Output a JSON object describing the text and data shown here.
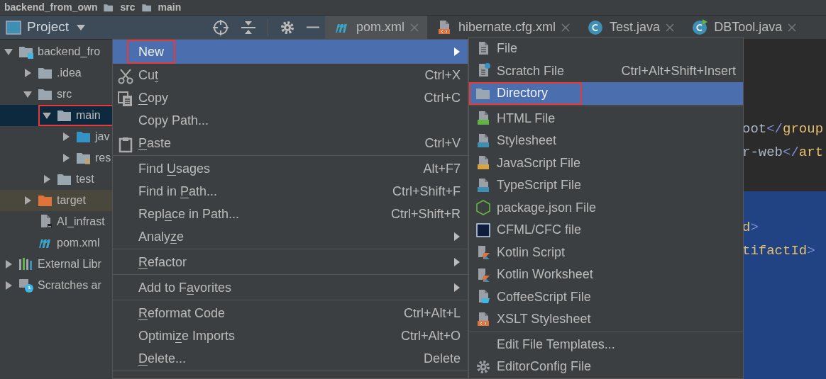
{
  "breadcrumb": [
    {
      "label": "backend_from_own",
      "kind": "project"
    },
    {
      "label": "src",
      "kind": "folder"
    },
    {
      "label": "main",
      "kind": "folder"
    }
  ],
  "project_panel": {
    "title": "Project"
  },
  "tabs": [
    {
      "label": "pom.xml",
      "kind": "maven",
      "selected": true
    },
    {
      "label": "hibernate.cfg.xml",
      "kind": "xml",
      "selected": false
    },
    {
      "label": "Test.java",
      "kind": "class",
      "selected": false
    },
    {
      "label": "DBTool.java",
      "kind": "runclass",
      "selected": false
    }
  ],
  "tree": [
    {
      "label": "backend_fro",
      "kind": "module",
      "expanded": true,
      "selected": false,
      "highlighted": false,
      "boxed": false,
      "children": [
        {
          "label": ".idea",
          "kind": "folder",
          "expanded": false,
          "selected": false,
          "highlighted": false,
          "boxed": false
        },
        {
          "label": "src",
          "kind": "folder",
          "expanded": true,
          "selected": false,
          "highlighted": false,
          "boxed": false,
          "children": [
            {
              "label": "main",
              "kind": "folder",
              "expanded": true,
              "selected": true,
              "highlighted": false,
              "boxed": true,
              "children": [
                {
                  "label": "jav",
                  "kind": "source",
                  "expanded": false,
                  "selected": false,
                  "highlighted": false,
                  "boxed": false
                },
                {
                  "label": "res",
                  "kind": "resources",
                  "expanded": false,
                  "selected": false,
                  "highlighted": false,
                  "boxed": false
                }
              ]
            },
            {
              "label": "test",
              "kind": "folder",
              "expanded": false,
              "selected": false,
              "highlighted": false,
              "boxed": false
            }
          ]
        },
        {
          "label": "target",
          "kind": "excluded",
          "expanded": false,
          "selected": false,
          "highlighted": true,
          "boxed": false
        },
        {
          "label": "AI_infrast",
          "kind": "iml",
          "selected": false,
          "highlighted": false,
          "boxed": false
        },
        {
          "label": "pom.xml",
          "kind": "maven",
          "selected": false,
          "highlighted": false,
          "boxed": false
        }
      ]
    },
    {
      "label": "External Libr",
      "kind": "library",
      "expanded": false,
      "selected": false,
      "highlighted": false,
      "boxed": false
    },
    {
      "label": "Scratches ar",
      "kind": "scratches",
      "expanded": false,
      "selected": false,
      "highlighted": false,
      "boxed": false
    }
  ],
  "editor": {
    "lines": [
      {
        "selected": false,
        "tokens": [
          {
            "text": "oot",
            "kind": "text"
          },
          {
            "text": "</",
            "kind": "bracket"
          },
          {
            "text": "group",
            "kind": "tag"
          }
        ]
      },
      {
        "selected": false,
        "tokens": [
          {
            "text": "r-web",
            "kind": "text"
          },
          {
            "text": "</",
            "kind": "bracket"
          },
          {
            "text": "art",
            "kind": "tag"
          }
        ]
      },
      {
        "selected": true,
        "tokens": [
          {
            "text": "d",
            "kind": "tag"
          },
          {
            "text": ">",
            "kind": "bracket"
          }
        ]
      },
      {
        "selected": true,
        "tokens": [
          {
            "text": "tifactId",
            "kind": "tag"
          },
          {
            "text": ">",
            "kind": "bracket"
          }
        ]
      }
    ]
  },
  "context_menu": {
    "items": [
      {
        "kind": "plain",
        "label": [
          "New"
        ],
        "has_submenu": true,
        "selected": true,
        "boxed": true
      },
      {
        "kind": "scissors",
        "label": [
          "Cu",
          {
            "u": "t"
          }
        ],
        "shortcut": "Ctrl+X",
        "has_submenu": false,
        "selected": false,
        "boxed": false
      },
      {
        "kind": "copy",
        "label": [
          {
            "u": "C"
          },
          "opy"
        ],
        "shortcut": "Ctrl+C",
        "has_submenu": false,
        "selected": false,
        "boxed": false
      },
      {
        "kind": "plain",
        "label": [
          "Copy Path..."
        ],
        "has_submenu": false,
        "selected": false,
        "boxed": false
      },
      {
        "kind": "paste",
        "label": [
          {
            "u": "P"
          },
          "aste"
        ],
        "shortcut": "Ctrl+V",
        "has_submenu": false,
        "selected": false,
        "boxed": false
      },
      {
        "kind": "separator"
      },
      {
        "kind": "plain",
        "label": [
          "Find ",
          {
            "u": "U"
          },
          "sages"
        ],
        "shortcut": "Alt+F7",
        "has_submenu": false,
        "selected": false,
        "boxed": false
      },
      {
        "kind": "plain",
        "label": [
          "Find in ",
          {
            "u": "P"
          },
          "ath..."
        ],
        "shortcut": "Ctrl+Shift+F",
        "has_submenu": false,
        "selected": false,
        "boxed": false
      },
      {
        "kind": "plain",
        "label": [
          "Repl",
          {
            "u": "a"
          },
          "ce in Path..."
        ],
        "shortcut": "Ctrl+Shift+R",
        "has_submenu": false,
        "selected": false,
        "boxed": false
      },
      {
        "kind": "plain",
        "label": [
          "Analy",
          {
            "u": "z"
          },
          "e"
        ],
        "has_submenu": true,
        "selected": false,
        "boxed": false
      },
      {
        "kind": "separator"
      },
      {
        "kind": "plain",
        "label": [
          {
            "u": "R"
          },
          "efactor"
        ],
        "has_submenu": true,
        "selected": false,
        "boxed": false
      },
      {
        "kind": "separator"
      },
      {
        "kind": "plain",
        "label": [
          "Add to F",
          {
            "u": "a"
          },
          "vorites"
        ],
        "has_submenu": true,
        "selected": false,
        "boxed": false
      },
      {
        "kind": "separator"
      },
      {
        "kind": "plain",
        "label": [
          {
            "u": "R"
          },
          "eformat Code"
        ],
        "shortcut": "Ctrl+Alt+L",
        "has_submenu": false,
        "selected": false,
        "boxed": false
      },
      {
        "kind": "plain",
        "label": [
          "Optimi",
          {
            "u": "z"
          },
          "e Imports"
        ],
        "shortcut": "Ctrl+Alt+O",
        "has_submenu": false,
        "selected": false,
        "boxed": false
      },
      {
        "kind": "plain",
        "label": [
          {
            "u": "D"
          },
          "elete..."
        ],
        "shortcut": "Delete",
        "has_submenu": false,
        "selected": false,
        "boxed": false
      },
      {
        "kind": "separator"
      }
    ]
  },
  "submenu": {
    "items": [
      {
        "kind": "file",
        "label": "File",
        "selected": false,
        "boxed": false
      },
      {
        "kind": "scratch",
        "label": "Scratch File",
        "shortcut": "Ctrl+Alt+Shift+Insert",
        "selected": false,
        "boxed": false
      },
      {
        "kind": "folder",
        "label": "Directory",
        "selected": true,
        "boxed": true
      },
      {
        "kind": "separator"
      },
      {
        "kind": "html",
        "label": "HTML File",
        "selected": false,
        "boxed": false
      },
      {
        "kind": "css",
        "label": "Stylesheet",
        "selected": false,
        "boxed": false
      },
      {
        "kind": "js",
        "label": "JavaScript File",
        "selected": false,
        "boxed": false
      },
      {
        "kind": "ts",
        "label": "TypeScript File",
        "selected": false,
        "boxed": false
      },
      {
        "kind": "node",
        "label": "package.json File",
        "selected": false,
        "boxed": false
      },
      {
        "kind": "cf",
        "label": "CFML/CFC file",
        "selected": false,
        "boxed": false
      },
      {
        "kind": "kotlin",
        "label": "Kotlin Script",
        "selected": false,
        "boxed": false
      },
      {
        "kind": "kotlin",
        "label": "Kotlin Worksheet",
        "selected": false,
        "boxed": false
      },
      {
        "kind": "coffee",
        "label": "CoffeeScript File",
        "selected": false,
        "boxed": false
      },
      {
        "kind": "xml",
        "label": "XSLT Stylesheet",
        "selected": false,
        "boxed": false
      },
      {
        "kind": "separator"
      },
      {
        "kind": "plain",
        "label": "Edit File Templates...",
        "selected": false,
        "boxed": false
      },
      {
        "kind": "gear",
        "label": "EditorConfig File",
        "selected": false,
        "boxed": false
      }
    ]
  }
}
